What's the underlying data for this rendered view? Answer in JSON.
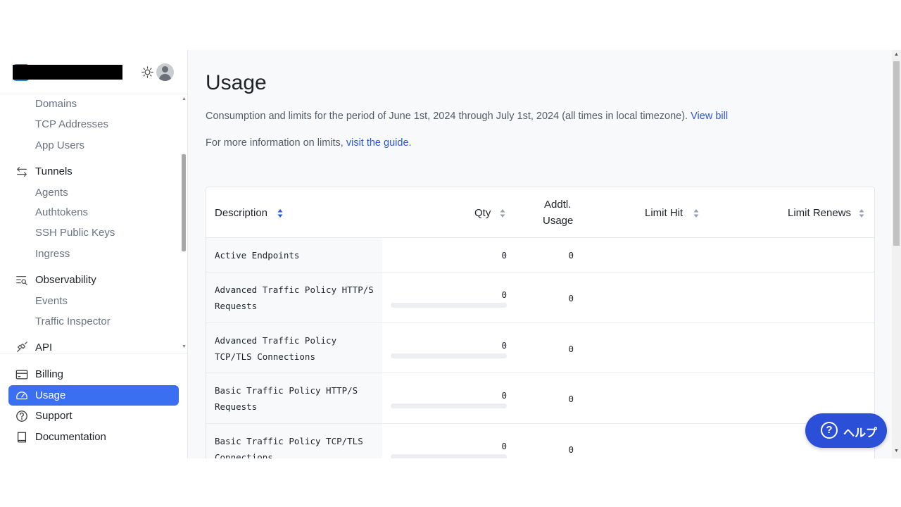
{
  "sidebar": {
    "scroll_items": [
      {
        "label": "Domains",
        "type": "sub"
      },
      {
        "label": "TCP Addresses",
        "type": "sub"
      },
      {
        "label": "App Users",
        "type": "sub"
      },
      {
        "label": "Tunnels",
        "type": "main",
        "icon": "arrows-swap-icon"
      },
      {
        "label": "Agents",
        "type": "sub"
      },
      {
        "label": "Authtokens",
        "type": "sub"
      },
      {
        "label": "SSH Public Keys",
        "type": "sub"
      },
      {
        "label": "Ingress",
        "type": "sub"
      },
      {
        "label": "Observability",
        "type": "main",
        "icon": "observability-icon"
      },
      {
        "label": "Events",
        "type": "sub"
      },
      {
        "label": "Traffic Inspector",
        "type": "sub"
      },
      {
        "label": "API",
        "type": "main",
        "icon": "api-plug-icon"
      }
    ],
    "bottom_items": [
      {
        "label": "Billing",
        "icon": "billing-card-icon",
        "active": false
      },
      {
        "label": "Usage",
        "icon": "gauge-icon",
        "active": true
      },
      {
        "label": "Support",
        "icon": "help-circle-icon",
        "active": false
      },
      {
        "label": "Documentation",
        "icon": "book-icon",
        "active": false
      }
    ]
  },
  "main": {
    "title": "Usage",
    "description": "Consumption and limits for the period of June 1st, 2024 through July 1st, 2024 (all times in local timezone).",
    "view_bill_link": "View bill",
    "info_prefix": "For more information on limits,",
    "guide_link": "visit the guide."
  },
  "table": {
    "headers": {
      "description": "Description",
      "qty": "Qty",
      "addtl_line1": "Addtl.",
      "addtl_line2": "Usage",
      "limit_hit": "Limit Hit",
      "limit_renews": "Limit Renews"
    },
    "rows": [
      {
        "line1": "Active Endpoints",
        "line2": "",
        "qty": "0",
        "addtl": "0",
        "bar": false
      },
      {
        "line1": "Advanced Traffic Policy HTTP/S",
        "line2": "Requests",
        "qty": "0",
        "addtl": "0",
        "bar": true
      },
      {
        "line1": "Advanced Traffic Policy",
        "line2": "TCP/TLS Connections",
        "qty": "0",
        "addtl": "0",
        "bar": true
      },
      {
        "line1": "Basic Traffic Policy HTTP/S",
        "line2": "Requests",
        "qty": "0",
        "addtl": "0",
        "bar": true
      },
      {
        "line1": "Basic Traffic Policy TCP/TLS",
        "line2": "Connections",
        "qty": "0",
        "addtl": "0",
        "bar": true
      }
    ]
  },
  "help_button": {
    "label": "ヘルプ"
  },
  "colors": {
    "accent": "#3b6ff2",
    "link": "#2b57d9",
    "help": "#2b4fd6"
  }
}
